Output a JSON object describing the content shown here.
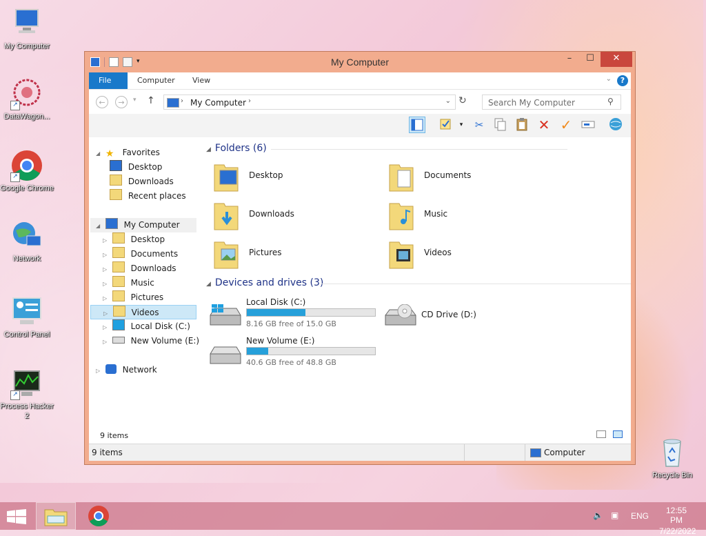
{
  "desktop": {
    "icons": [
      {
        "label": "My Computer"
      },
      {
        "label": "DataWagon..."
      },
      {
        "label": "Google Chrome"
      },
      {
        "label": "Network"
      },
      {
        "label": "Control Panel"
      },
      {
        "label": "Process Hacker 2"
      },
      {
        "label": "Recycle Bin"
      }
    ]
  },
  "window": {
    "title": "My Computer",
    "controls": {
      "minimize": "–",
      "maximize": "☐",
      "close": "✕"
    },
    "ribbon": {
      "file": "File",
      "computer": "Computer",
      "view": "View",
      "help": "?"
    },
    "address": {
      "path": "My Computer",
      "separator": "›"
    },
    "search": {
      "placeholder": "Search My Computer"
    },
    "nav": {
      "favorites": "Favorites",
      "fav_items": [
        "Desktop",
        "Downloads",
        "Recent places"
      ],
      "computer": "My Computer",
      "computer_items": [
        "Desktop",
        "Documents",
        "Downloads",
        "Music",
        "Pictures",
        "Videos",
        "Local Disk (C:)",
        "New Volume (E:)"
      ],
      "network": "Network"
    },
    "folders_group": "Folders (6)",
    "folders": [
      "Desktop",
      "Documents",
      "Downloads",
      "Music",
      "Pictures",
      "Videos"
    ],
    "drives_group": "Devices and drives (3)",
    "drives": [
      {
        "name": "Local Disk (C:)",
        "free": "8.16 GB free of 15.0 GB",
        "used_fraction": 0.456
      },
      {
        "name": "CD Drive (D:)"
      },
      {
        "name": "New Volume (E:)",
        "free": "40.6 GB free of 48.8 GB",
        "used_fraction": 0.168
      }
    ],
    "item_count": "9 items",
    "status": {
      "left": "9 items",
      "right": "Computer"
    }
  },
  "taskbar": {
    "lang": "ENG",
    "time": "12:55 PM",
    "date": "7/22/2022"
  },
  "colors": {
    "accent": "#1979ca",
    "window_frame": "#f2ac8e",
    "drive_bar": "#26a0da"
  }
}
